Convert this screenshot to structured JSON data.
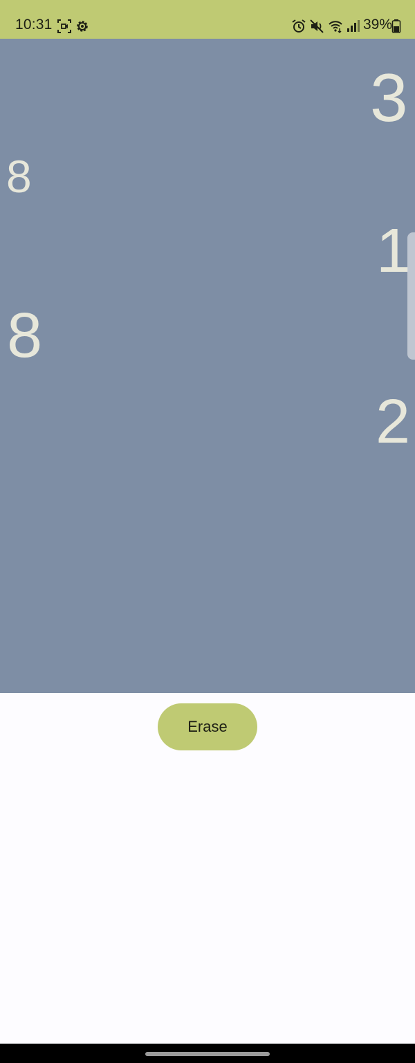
{
  "status_bar": {
    "time": "10:31",
    "battery": "39%",
    "background_color": "#bfca73",
    "icons": [
      "screen-record-icon",
      "settings-gear-icon",
      "alarm-icon",
      "mute-icon",
      "wifi-icon",
      "signal-icon",
      "battery-icon"
    ]
  },
  "canvas": {
    "background_color": "#7e8ea5",
    "digits": [
      "3",
      "8",
      "1",
      "8",
      "2"
    ]
  },
  "erase_button": {
    "label": "Erase",
    "color": "#bfca73"
  }
}
